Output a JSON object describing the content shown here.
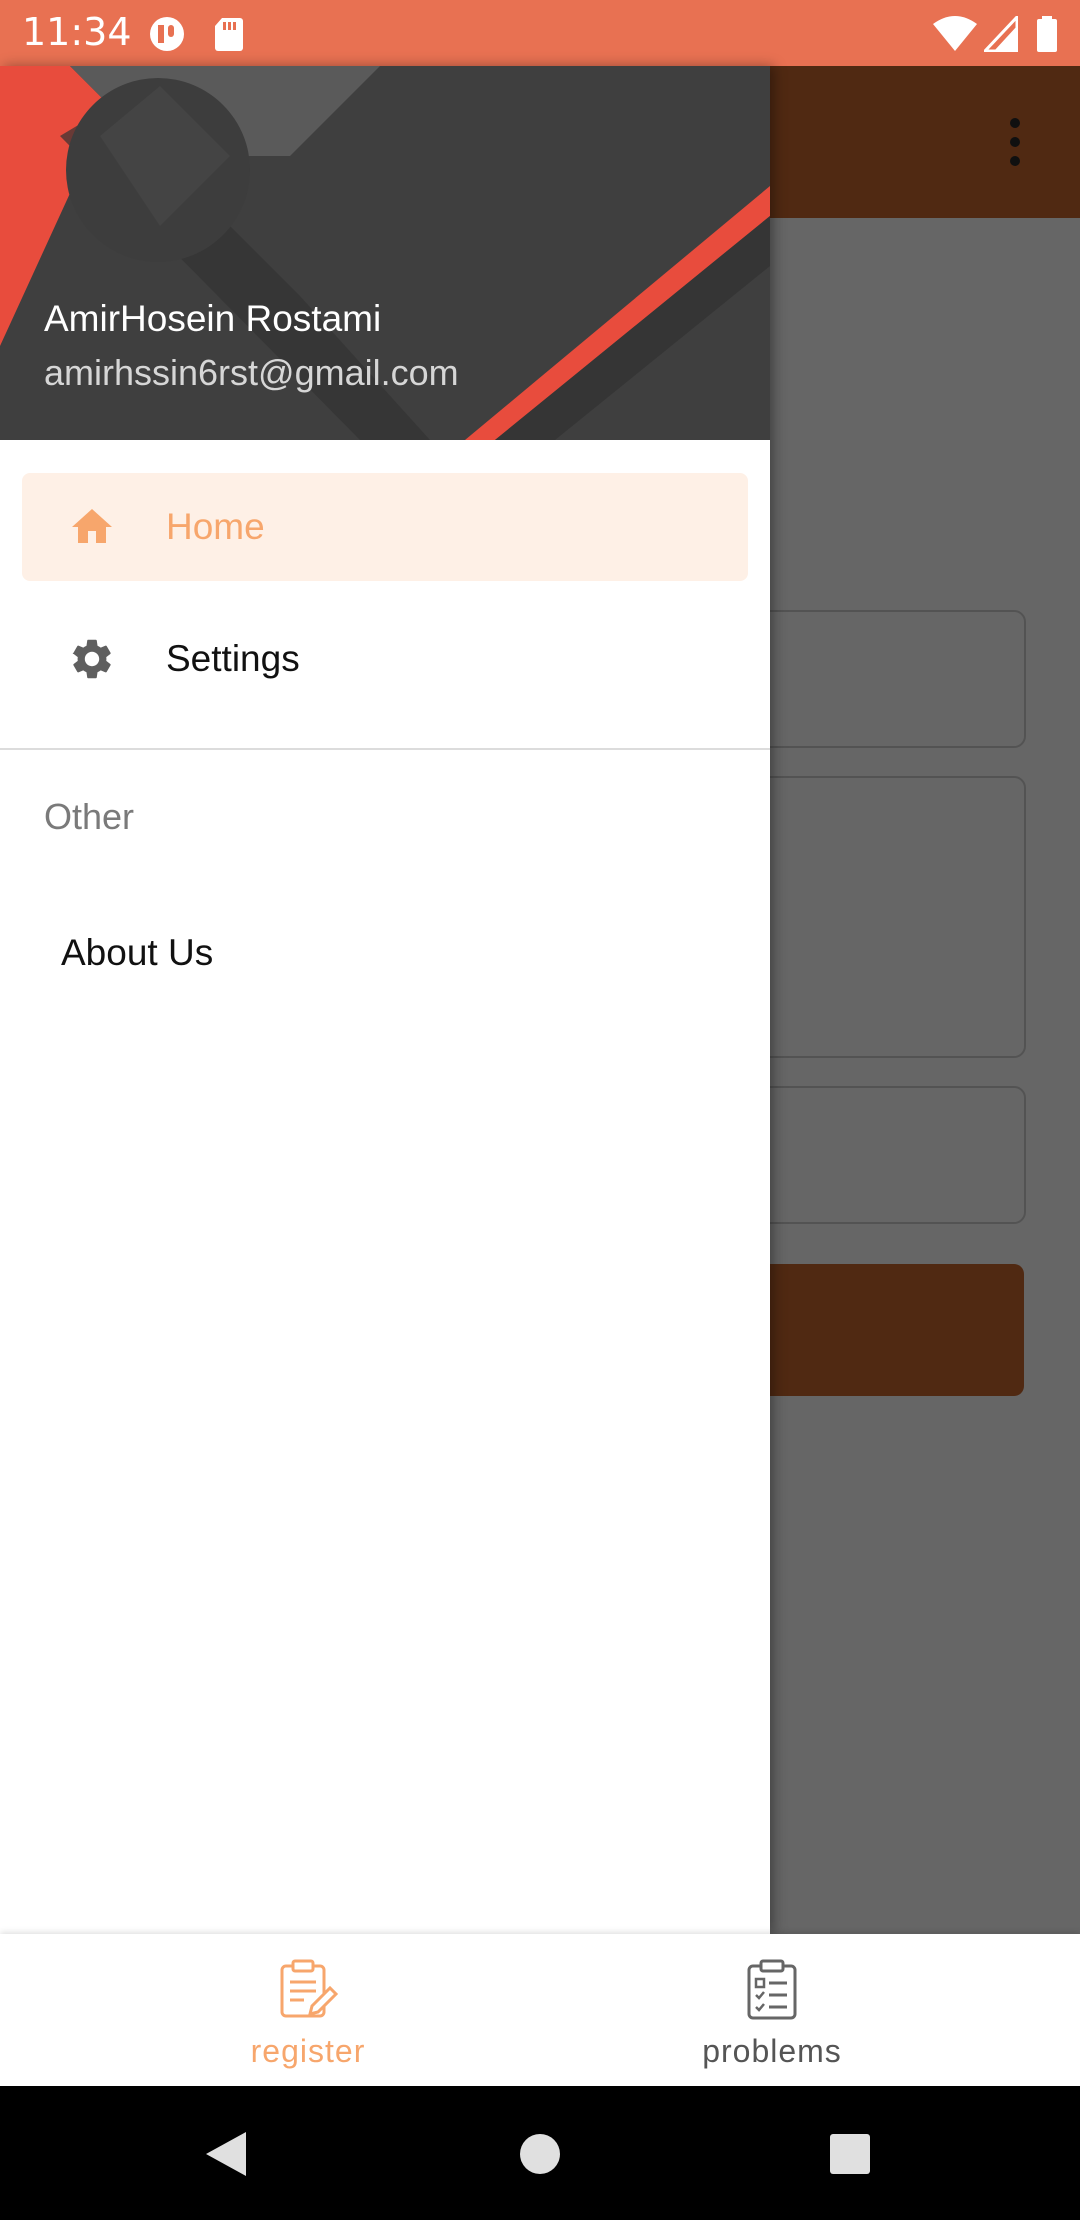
{
  "status_bar": {
    "time": "11:34",
    "icons": [
      "app-notification-icon",
      "sd-card-icon",
      "wifi-icon",
      "signal-icon",
      "battery-icon"
    ]
  },
  "drawer": {
    "header": {
      "name": "AmirHosein Rostami",
      "email": "amirhssin6rst@gmail.com"
    },
    "items": [
      {
        "label": "Home",
        "icon": "home-icon",
        "active": true
      },
      {
        "label": "Settings",
        "icon": "gear-icon",
        "active": false
      }
    ],
    "section_title": "Other",
    "other_items": [
      {
        "label": "About Us"
      }
    ]
  },
  "bottom_nav": {
    "items": [
      {
        "label": "register",
        "icon": "clipboard-edit-icon",
        "active": true
      },
      {
        "label": "problems",
        "icon": "checklist-icon",
        "active": false
      }
    ]
  },
  "colors": {
    "status_bar": "#E87152",
    "accent": "#F7A66C",
    "active_item_bg": "#FEF0E6",
    "toolbar": "#C8662E",
    "header_red": "#E84C3D",
    "header_dark": "#3d3d3d"
  }
}
